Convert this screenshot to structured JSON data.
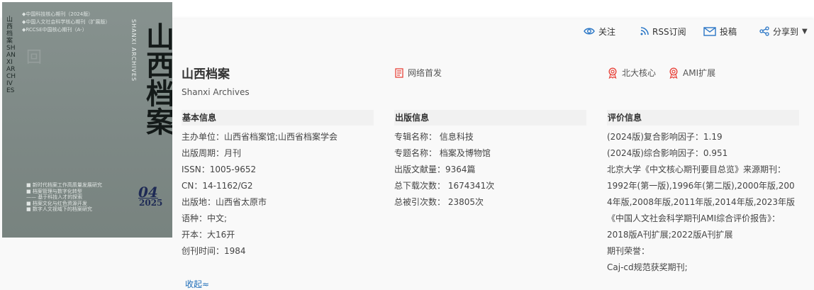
{
  "cover": {
    "spine_text": "山西档案 SHANXI ARCHIVES",
    "bullets": [
      "◆中国科技核心期刊（2024版）",
      "◆中国人文社会科学核心期刊（扩展版）",
      "◆RCCSE中国核心期刊（A-）"
    ],
    "title": "山西档案",
    "english": "SHANXI ARCHIVES",
    "toc": [
      "■ 新时代档案工作高质量发展研究",
      "■ 档案管理与数字化转型",
      "—— 基于科技人才的探索",
      "■ 档案文化与红色资源开发",
      "■ 数字人文视域下的档案研究"
    ],
    "issue": "04",
    "year": "2025"
  },
  "actions": {
    "follow": "关注",
    "rss": "RSS订阅",
    "submit": "投稿",
    "share": "分享到",
    "share_caret": "▼"
  },
  "journal": {
    "title": "山西档案",
    "subtitle": "Shanxi Archives",
    "online_first": "网络首发",
    "tags": [
      "北大核心",
      "AMI扩展"
    ]
  },
  "basic_info": {
    "heading": "基本信息",
    "rows": [
      "主办单位：山西省档案馆;山西省档案学会",
      "出版周期：月刊",
      "ISSN：1005-9652",
      "CN：14-1162/G2",
      "出版地：山西省太原市",
      "语种：中文;",
      "开本：大16开",
      "创刊时间：1984"
    ]
  },
  "publish_info": {
    "heading": "出版信息",
    "rows": [
      "专辑名称：  信息科技",
      "专题名称：  档案及博物馆",
      "出版文献量：9364篇",
      "总下载次数：  1674341次",
      "总被引次数：  23805次"
    ]
  },
  "eval_info": {
    "heading": "评价信息",
    "rows": [
      "(2024版)复合影响因子：1.19",
      "(2024版)综合影响因子：0.951",
      "北京大学《中文核心期刊要目总览》来源期刊：",
      "1992年(第一版),1996年(第二版),2000年版,2004年版,2008年版,2011年版,2014年版,2023年版",
      "《中国人文社会科学期刊AMI综合评价报告》：",
      "2018版A刊扩展;2022版A刊扩展",
      "期刊荣誉：",
      "Caj-cd规范获奖期刊;"
    ]
  },
  "collapse_label": "收起≈",
  "colors": {
    "link": "#1e6db8",
    "icon_blue": "#2a76c6",
    "icon_red": "#e8453c",
    "header_bg": "#f1f1f1"
  }
}
